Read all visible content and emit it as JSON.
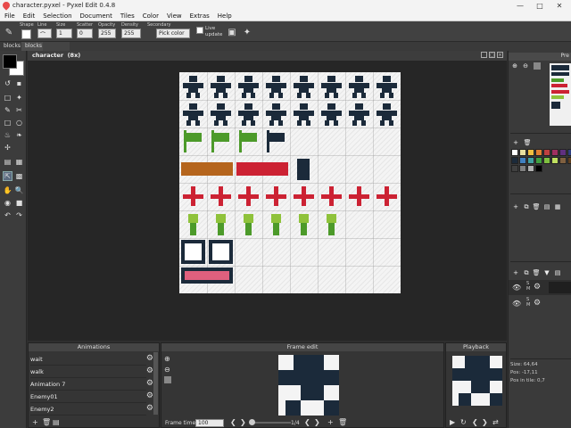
{
  "window": {
    "title": "character.pyxel - Pyxel Edit 0.4.8"
  },
  "menu": [
    "File",
    "Edit",
    "Selection",
    "Document",
    "Tiles",
    "Color",
    "View",
    "Extras",
    "Help"
  ],
  "toolbar": {
    "shape_label": "Shape",
    "line_label": "Line",
    "size_label": "Size",
    "size_value": "1",
    "scatter_label": "Scatter",
    "scatter_value": "0",
    "opacity_label": "Opacity",
    "opacity_value": "255",
    "density_label": "Density",
    "density_value": "255",
    "secondary_label": "Secondary",
    "secondary_value": "Pick color",
    "live_update_label": "Live update"
  },
  "tabs": [
    "blocks",
    "blocks"
  ],
  "canvas": {
    "title": "character",
    "zoom": "(8x)"
  },
  "right_panel": {
    "preview_label": "Pre"
  },
  "animations": {
    "title": "Animations",
    "items": [
      "wait",
      "walk",
      "Animation 7",
      "Enemy01",
      "Enemy2"
    ]
  },
  "frame_edit": {
    "title": "Frame edit",
    "frame_time_label": "Frame time",
    "frame_time_value": "100",
    "frame_counter": "1/4"
  },
  "playback": {
    "title": "Playback"
  },
  "info": {
    "size": "Size: 64,64",
    "pos": "Pos: -17,11",
    "pos_in_tile": "Pos in tile: 0,7"
  },
  "colors": {
    "navy": "#1b2a3a",
    "green": "#4c9a2a",
    "brown": "#b5651d",
    "red": "#cc2233",
    "pink": "#e0607e",
    "lime": "#8fc23b"
  },
  "palette": [
    "#ffffff",
    "#e8e0a0",
    "#f0c040",
    "#e08030",
    "#c04040",
    "#a03060",
    "#603080",
    "#304080",
    "#1b2a3a",
    "#4080c0",
    "#40a0a0",
    "#40a040",
    "#80c040",
    "#c0e060",
    "#806040",
    "#604020",
    "#404040",
    "#808080",
    "#b0b0b0",
    "#000000"
  ]
}
